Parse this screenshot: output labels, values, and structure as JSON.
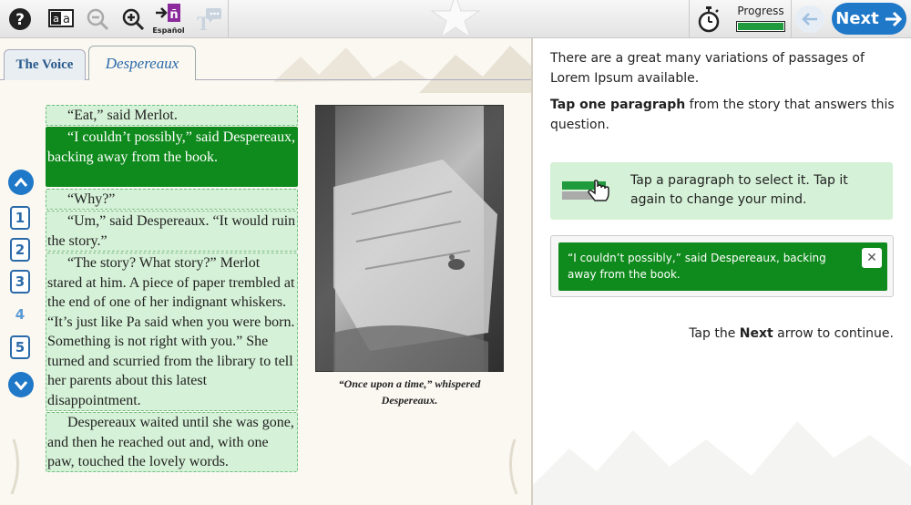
{
  "toolbar": {
    "espanol_label": "Español",
    "progress_label": "Progress",
    "progress_fraction": 1.0,
    "next_label": "Next"
  },
  "tabs": [
    {
      "label": "The Voice"
    },
    {
      "label": "Despereaux"
    }
  ],
  "pages": [
    "1",
    "2",
    "3",
    "4",
    "5"
  ],
  "active_page": "4",
  "paragraphs": [
    "“Eat,” said Merlot.",
    "“I couldn’t possibly,” said Despereaux, backing away from the book.",
    "“Why?”",
    "“Um,” said Despereaux. “It would ruin the story.”",
    "“The story? What story?” Merlot stared at him. A piece of paper trembled at the end of one of her indignant whiskers. “It’s just like Pa said when you were born. Something is not right with you.” She turned and scurried from the library to tell her parents about this latest disappointment.",
    "Despereaux waited until she was gone, and then he reached out and, with one paw, touched the lovely words."
  ],
  "caption": {
    "line1": "“Once upon a time,” whispered",
    "line2": "Despereaux."
  },
  "question": {
    "intro": "There are a great many variations of passages of Lorem Ipsum available.",
    "prompt_bold": "Tap one paragraph",
    "prompt_rest": " from the story that answers this question."
  },
  "hint": "Tap a paragraph to select it. Tap it again to change your mind.",
  "answer": "“I couldn’t possibly,” said Despereaux, backing away from the book.",
  "next_hint": {
    "pre": "Tap the ",
    "bold": "Next",
    "post": " arrow to continue."
  },
  "colors": {
    "accent_blue": "#1f78c8",
    "selected_green": "#0f8a1c",
    "paragraph_bg": "#d5f1d7"
  }
}
